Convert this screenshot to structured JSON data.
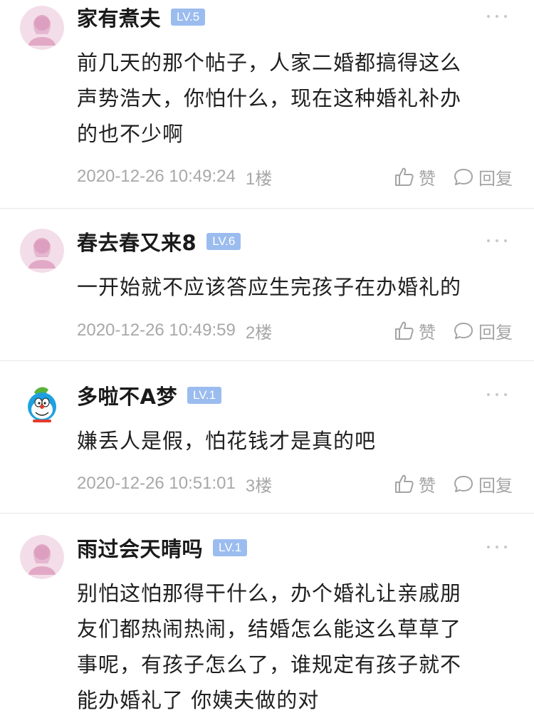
{
  "comments": [
    {
      "username": "家有煮夫",
      "level": "LV.5",
      "avatar": "pink-woman-avatar",
      "lines": [
        "前几天的那个帖子，人家二婚都搞得这么",
        "声势浩大，你怕什么，现在这种婚礼补办",
        "的也不少啊"
      ],
      "time": "2020-12-26 10:49:24",
      "floor": "1楼",
      "like_label": "赞",
      "reply_label": "回复"
    },
    {
      "username": "春去春又来8",
      "level": "LV.6",
      "avatar": "pink-woman-avatar",
      "lines": [
        "一开始就不应该答应生完孩子在办婚礼的"
      ],
      "time": "2020-12-26 10:49:59",
      "floor": "2楼",
      "like_label": "赞",
      "reply_label": "回复"
    },
    {
      "username": "多啦不A梦",
      "level": "LV.1",
      "avatar": "doraemon-avatar",
      "lines": [
        "嫌丢人是假，怕花钱才是真的吧"
      ],
      "time": "2020-12-26 10:51:01",
      "floor": "3楼",
      "like_label": "赞",
      "reply_label": "回复"
    },
    {
      "username": "雨过会天晴吗",
      "level": "LV.1",
      "avatar": "pink-woman-avatar",
      "lines": [
        "别怕这怕那得干什么，办个婚礼让亲戚朋",
        "友们都热闹热闹，结婚怎么能这么草草了",
        "事呢，有孩子怎么了，谁规定有孩子就不",
        "能办婚礼了 你姨夫做的对"
      ]
    }
  ],
  "colors": {
    "badge": "#9bbcef",
    "meta_text": "#a4a4a4",
    "divider": "#e6e6e6"
  }
}
